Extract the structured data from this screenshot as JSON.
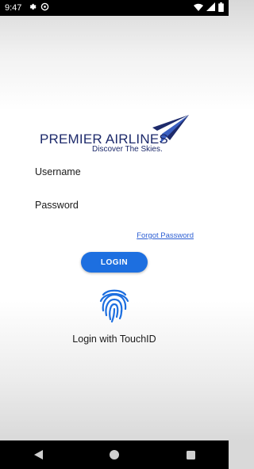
{
  "status_bar": {
    "time": "9:47",
    "left_icons": [
      "gear-icon",
      "at-icon"
    ],
    "right_icons": [
      "wifi-icon",
      "signal-icon",
      "battery-icon"
    ]
  },
  "logo": {
    "brand": "PREMIER AIRLINES",
    "tagline": "Discover The Skies.",
    "color": "#1d2a6b"
  },
  "form": {
    "username_label": "Username",
    "password_label": "Password",
    "forgot_password": "Forgot Password",
    "login_button": "LOGIN"
  },
  "touchid": {
    "icon": "fingerprint-icon",
    "label": "Login with TouchID"
  },
  "nav_bar": [
    "back-icon",
    "home-icon",
    "recents-icon"
  ],
  "colors": {
    "accent": "#1d6fe0",
    "link": "#2d5fd3"
  }
}
